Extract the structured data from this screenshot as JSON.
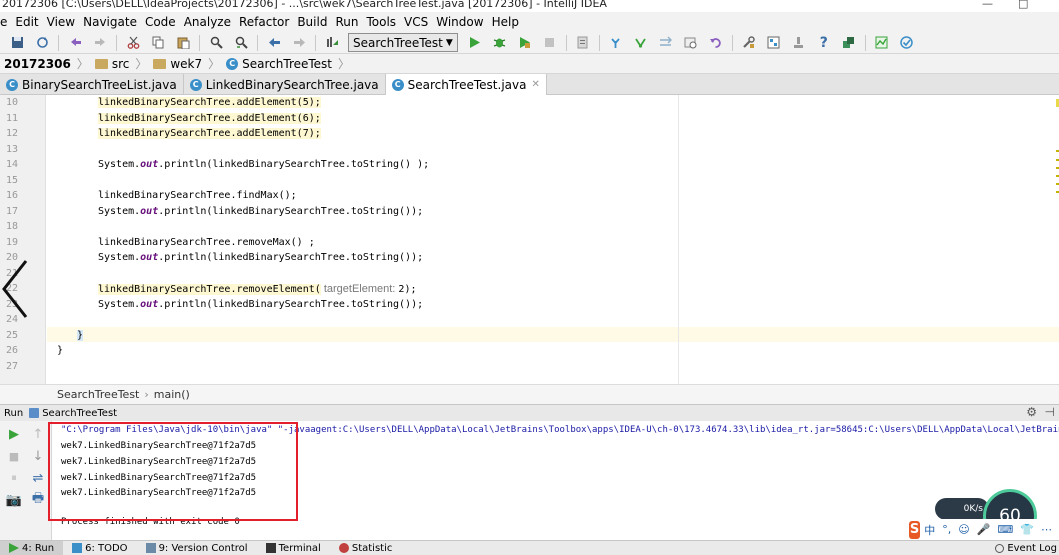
{
  "window": {
    "title": "20172306 [C:\\Users\\DELL\\IdeaProjects\\20172306] - ...\\src\\wek7\\SearchTreeTest.java [20172306] - IntelliJ IDEA",
    "controls": [
      "—",
      "□"
    ]
  },
  "menu": [
    "e",
    "Edit",
    "View",
    "Navigate",
    "Code",
    "Analyze",
    "Refactor",
    "Build",
    "Run",
    "Tools",
    "VCS",
    "Window",
    "Help"
  ],
  "toolbar": {
    "run_config": "SearchTreeTest",
    "icons": [
      "save-icon",
      "sync-icon",
      "undo-icon",
      "redo-icon",
      "cut-icon",
      "copy-icon",
      "paste-icon",
      "find-icon",
      "replace-icon",
      "back-icon",
      "forward-icon",
      "build-icon",
      "run-icon",
      "debug-icon",
      "coverage-icon",
      "stop-icon",
      "project-structure-icon",
      "vcs-update-icon",
      "vcs-commit-icon",
      "vcs-compare-icon",
      "vcs-history-icon",
      "vcs-revert-icon",
      "settings-icon",
      "structure-icon",
      "sdk-icon",
      "help-icon",
      "plugin-icon",
      "jvm-icon",
      "check-icon"
    ]
  },
  "navbar": {
    "project": "20172306",
    "src": "src",
    "package": "wek7",
    "file": "SearchTreeTest"
  },
  "tabs": [
    {
      "label": "BinarySearchTreeList.java",
      "active": false
    },
    {
      "label": "LinkedBinarySearchTree.java",
      "active": false
    },
    {
      "label": "SearchTreeTest.java",
      "active": true
    }
  ],
  "editor": {
    "line_numbers": [
      "10",
      "11",
      "12",
      "13",
      "14",
      "15",
      "16",
      "17",
      "18",
      "19",
      "20",
      "21",
      "22",
      "23",
      "24",
      "25",
      "26",
      "27"
    ],
    "lines": {
      "l10": "linkedBinarySearchTree.addElement(5);",
      "l11": "linkedBinarySearchTree.addElement(6);",
      "l12": "linkedBinarySearchTree.addElement(7);",
      "l14_a": "System.",
      "l14_b": "out",
      "l14_c": ".println(linkedBinarySearchTree.toString() );",
      "l16": "linkedBinarySearchTree.findMax();",
      "l17_a": "System.",
      "l17_b": "out",
      "l17_c": ".println(linkedBinarySearchTree.toString());",
      "l19": "linkedBinarySearchTree.removeMax() ;",
      "l20_a": "System.",
      "l20_b": "out",
      "l20_c": ".println(linkedBinarySearchTree.toString());",
      "l22_a": "linkedBinarySearchTree.removeElement(",
      "l22_hint": " targetElement: ",
      "l22_b": "2);",
      "l23_a": "System.",
      "l23_b": "out",
      "l23_c": ".println(linkedBinarySearchTree.toString());",
      "l25": "}",
      "l26": "}"
    }
  },
  "code_breadcrumb": {
    "class": "SearchTreeTest",
    "method": "main()"
  },
  "run_panel": {
    "label": "Run",
    "tab": "SearchTreeTest",
    "console": {
      "command": "\"C:\\Program Files\\Java\\jdk-10\\bin\\java\" \"-javaagent:C:\\Users\\DELL\\AppData\\Local\\JetBrains\\Toolbox\\apps\\IDEA-U\\ch-0\\173.4674.33\\lib\\idea_rt.jar=58645:C:\\Users\\DELL\\AppData\\Local\\JetBrains\\Toolbox",
      "output": [
        "wek7.LinkedBinarySearchTree@71f2a7d5",
        "wek7.LinkedBinarySearchTree@71f2a7d5",
        "wek7.LinkedBinarySearchTree@71f2a7d5",
        "wek7.LinkedBinarySearchTree@71f2a7d5"
      ],
      "finish": "Process finished with exit code 0"
    }
  },
  "widgets": {
    "net_speed": "0K/s",
    "net_gauge": "60",
    "ime_logo": "S",
    "ime_chars": [
      "中",
      "°,",
      "☺",
      "🎤",
      "⌨",
      "👕",
      "⋯"
    ]
  },
  "bottom_tabs": [
    {
      "label": "4: Run",
      "active": true
    },
    {
      "label": "6: TODO",
      "active": false
    },
    {
      "label": "9: Version Control",
      "active": false
    },
    {
      "label": "Terminal",
      "active": false
    },
    {
      "label": "Statistic",
      "active": false
    }
  ],
  "event_log": "Event Log",
  "colors": {
    "highlight_box": "#e21f2a",
    "run_green": "#3aa33a",
    "static_purple": "#660e7a"
  }
}
